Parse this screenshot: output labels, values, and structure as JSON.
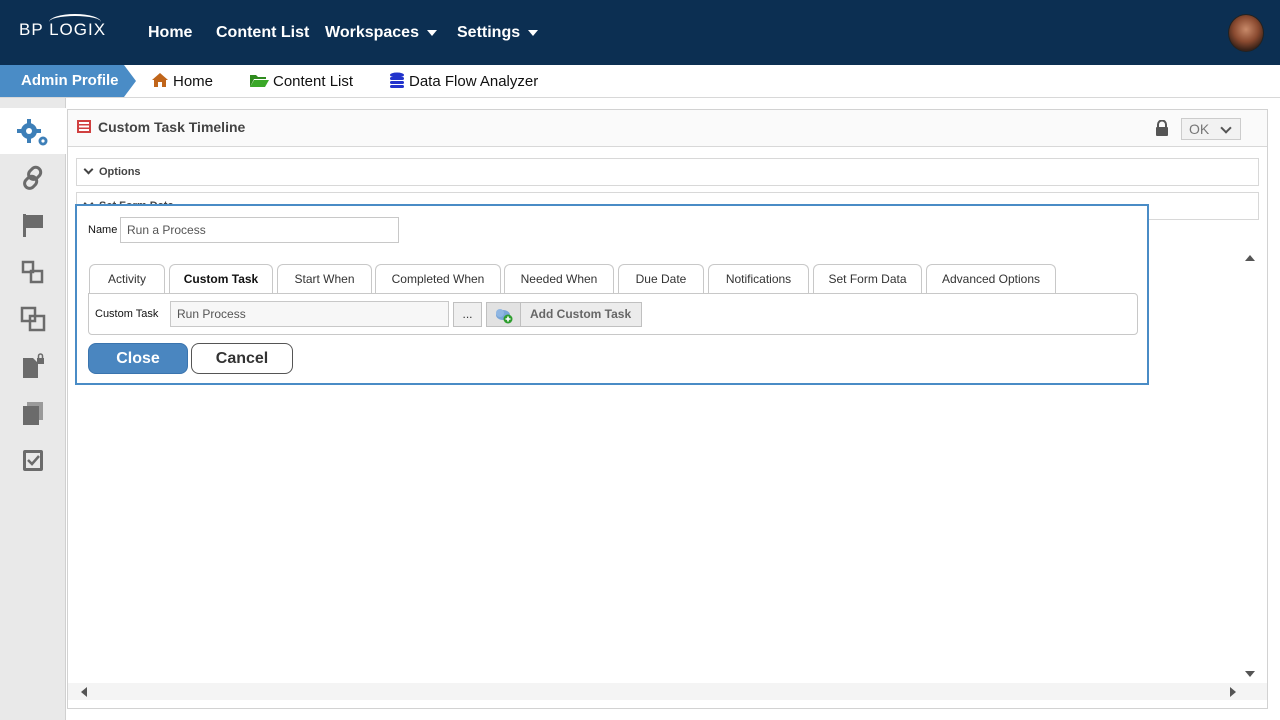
{
  "brand": {
    "logo_text": "BP LOGIX"
  },
  "nav": {
    "items": [
      {
        "label": "Home"
      },
      {
        "label": "Content List"
      },
      {
        "label": "Workspaces"
      },
      {
        "label": "Settings"
      }
    ]
  },
  "breadcrumb": {
    "profile": "Admin Profile",
    "items": [
      {
        "label": "Home",
        "icon": "home-icon"
      },
      {
        "label": "Content List",
        "icon": "folder-open-icon"
      },
      {
        "label": "Data Flow Analyzer",
        "icon": "database-icon"
      }
    ]
  },
  "rail": {
    "icons": [
      "gears-icon",
      "link-icon",
      "flag-icon",
      "workflow-icon",
      "copy-icon",
      "locked-document-icon",
      "documents-icon",
      "checked-document-icon"
    ]
  },
  "panel": {
    "title": "Custom Task Timeline",
    "ok_label": "OK",
    "sections": [
      {
        "label": "Options"
      },
      {
        "label": "Set Form Data"
      }
    ]
  },
  "dialog": {
    "name_label": "Name",
    "name_value": "Run a Process",
    "tabs": [
      {
        "label": "Activity"
      },
      {
        "label": "Custom Task"
      },
      {
        "label": "Start When"
      },
      {
        "label": "Completed When"
      },
      {
        "label": "Needed When"
      },
      {
        "label": "Due Date"
      },
      {
        "label": "Notifications"
      },
      {
        "label": "Set Form Data"
      },
      {
        "label": "Advanced Options"
      }
    ],
    "active_tab": "Custom Task",
    "custom_task_label": "Custom Task",
    "custom_task_value": "Run Process",
    "browse_label": "...",
    "add_label": "Add Custom Task",
    "close_label": "Close",
    "cancel_label": "Cancel"
  },
  "colors": {
    "topbar": "#0c2f52",
    "accent": "#4a8cc6",
    "home_icon": "#c0651a",
    "folder_icon": "#2e8b1e",
    "database_icon": "#2233cc"
  }
}
